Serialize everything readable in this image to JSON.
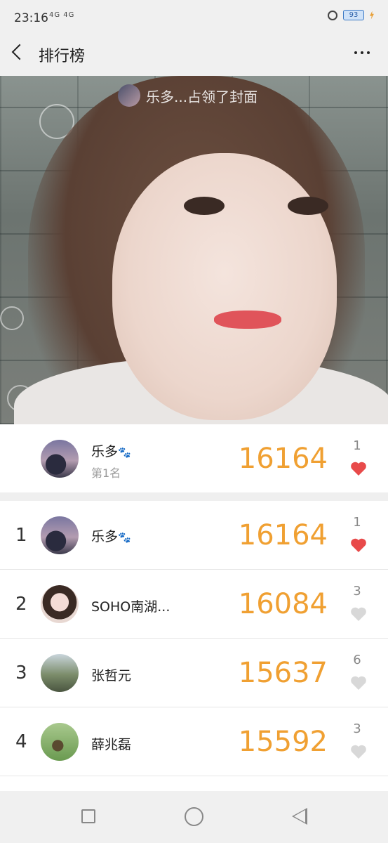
{
  "status_bar": {
    "time": "23:16",
    "signal": "4G 4G",
    "battery": "93"
  },
  "nav": {
    "title": "排行榜"
  },
  "cover": {
    "caption": "乐多...占领了封面"
  },
  "my_rank": {
    "name": "乐多",
    "paw": "🐾",
    "subtitle": "第1名",
    "score": "16164",
    "likes": "1",
    "liked": true
  },
  "rankings": [
    {
      "rank": "1",
      "name": "乐多",
      "paw": "🐾",
      "score": "16164",
      "likes": "1",
      "liked": true
    },
    {
      "rank": "2",
      "name": "SOHO南湖...",
      "paw": "",
      "score": "16084",
      "likes": "3",
      "liked": false
    },
    {
      "rank": "3",
      "name": "张哲元",
      "paw": "",
      "score": "15637",
      "likes": "6",
      "liked": false
    },
    {
      "rank": "4",
      "name": "薛兆磊",
      "paw": "",
      "score": "15592",
      "likes": "3",
      "liked": false
    }
  ],
  "colors": {
    "score": "#f0a032",
    "heart_liked": "#e84a4a",
    "heart_unliked": "#d8d8d8"
  }
}
